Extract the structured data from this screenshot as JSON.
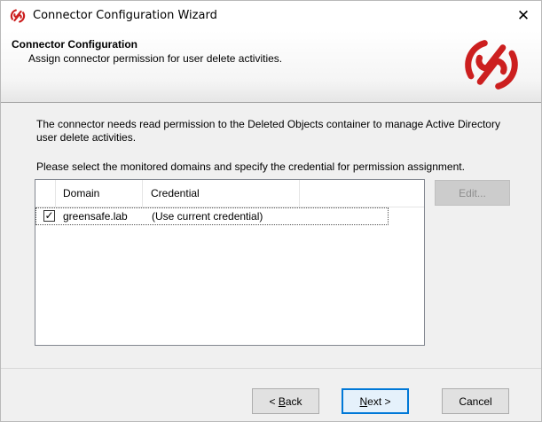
{
  "window": {
    "title": "Connector Configuration Wizard",
    "close_glyph": "✕"
  },
  "header": {
    "title": "Connector Configuration",
    "subtitle": "Assign connector permission for user delete activities.",
    "logo": "brand-logo-icon",
    "logo_color": "#cc1f1f"
  },
  "body": {
    "description": "The connector needs read permission to the Deleted Objects container to manage Active Directory user delete activities.",
    "instruction": "Please select the monitored domains and specify the credential for permission assignment."
  },
  "listview": {
    "columns": [
      "Domain",
      "Credential"
    ],
    "rows": [
      {
        "checked": true,
        "check_glyph": "✓",
        "domain": "greensafe.lab",
        "credential": "(Use current credential)"
      }
    ]
  },
  "buttons": {
    "edit": {
      "label": "Edit...",
      "enabled": false
    },
    "back": {
      "mnemonic": "B",
      "rest": "ack",
      "prefix": "< "
    },
    "next": {
      "mnemonic": "N",
      "rest": "ext",
      "suffix": " >"
    },
    "cancel": {
      "label": "Cancel"
    }
  }
}
